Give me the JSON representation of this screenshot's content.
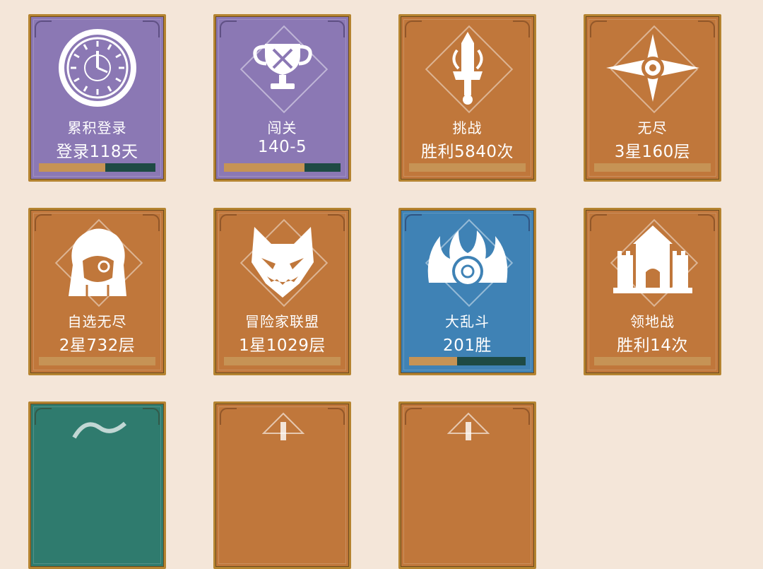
{
  "colors": {
    "background": "#f4e6d9",
    "purple": "#8b78b4",
    "orange": "#c0773b",
    "blue": "#3f82b5",
    "green": "#2f7b6e",
    "frame": "#b58431",
    "bar_fill": "#c69355",
    "bar_track_dark": "#1e4a44"
  },
  "cards": [
    {
      "icon": "clock-icon",
      "title": "累积登录",
      "value": "登录118天",
      "color": "purple",
      "progress": 0.57
    },
    {
      "icon": "trophy-icon",
      "title": "闯关",
      "value": "140-5",
      "color": "purple",
      "progress": 0.69
    },
    {
      "icon": "sword-icon",
      "title": "挑战",
      "value": "胜利5840次",
      "color": "orange",
      "progress": 1.0
    },
    {
      "icon": "compass-star-icon",
      "title": "无尽",
      "value": "3星160层",
      "color": "orange",
      "progress": 1.0
    },
    {
      "icon": "hero-portrait-icon",
      "title": "自选无尽",
      "value": "2星732层",
      "color": "orange",
      "progress": 1.0
    },
    {
      "icon": "fox-mask-icon",
      "title": "冒险家联盟",
      "value": "1星1029层",
      "color": "orange",
      "progress": 1.0
    },
    {
      "icon": "flame-emblem-icon",
      "title": "大乱斗",
      "value": "201胜",
      "color": "blue",
      "progress": 0.41
    },
    {
      "icon": "castle-icon",
      "title": "领地战",
      "value": "胜利14次",
      "color": "orange",
      "progress": 1.0
    },
    {
      "icon": "wave-icon",
      "title": "",
      "value": "",
      "color": "green",
      "progress": null
    },
    {
      "icon": "emblem-icon",
      "title": "",
      "value": "",
      "color": "orange",
      "progress": null
    },
    {
      "icon": "emblem-icon",
      "title": "",
      "value": "",
      "color": "orange",
      "progress": null
    }
  ]
}
